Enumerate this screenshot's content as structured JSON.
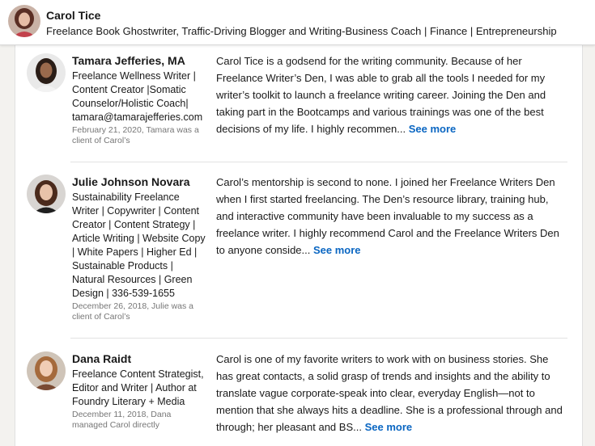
{
  "header": {
    "name": "Carol Tice",
    "headline": "Freelance Book Ghostwriter, Traffic-Driving Blogger and Writing-Business Coach | Finance | Entrepreneurship"
  },
  "recommendations": [
    {
      "name": "Tamara Jefferies, MA",
      "headline": "Freelance Wellness Writer | Content Creator |Somatic Counselor/Holistic Coach| tamara@tamarajefferies.com",
      "meta": "February 21, 2020, Tamara was a client of Carol’s",
      "text": "Carol Tice is a godsend for the writing community. Because of her Freelance Writer’s Den, I was able to grab all the tools I needed for my writer’s toolkit to launch a freelance writing career. Joining the Den and taking part in the Bootcamps and various trainings was one of the best decisions of my life. I highly recommen...",
      "see_more": "See more"
    },
    {
      "name": "Julie Johnson Novara",
      "headline": "Sustainability Freelance Writer | Copywriter | Content Creator | Content Strategy | Article Writing | Website Copy | White Papers | Higher Ed | Sustainable Products | Natural Resources | Green Design | 336-539-1655",
      "meta": "December 26, 2018, Julie was a client of Carol’s",
      "text": "Carol’s mentorship is second to none. I joined her Freelance Writers Den when I first started freelancing. The Den’s resource library, training hub, and interactive community have been invaluable to my success as a freelance writer. I highly recommend Carol and the Freelance Writers Den to anyone conside...",
      "see_more": "See more"
    },
    {
      "name": "Dana Raidt",
      "headline": "Freelance Content Strategist, Editor and Writer | Author at Foundry Literary + Media",
      "meta": "December 11, 2018, Dana managed Carol directly",
      "text": "Carol is one of my favorite writers to work with on business stories. She has great contacts, a solid grasp of trends and insights and the ability to translate vague corporate-speak into clear, everyday English—not to mention that she always hits a deadline. She is a professional through and through; her pleasant and BS...",
      "see_more": "See more"
    }
  ]
}
